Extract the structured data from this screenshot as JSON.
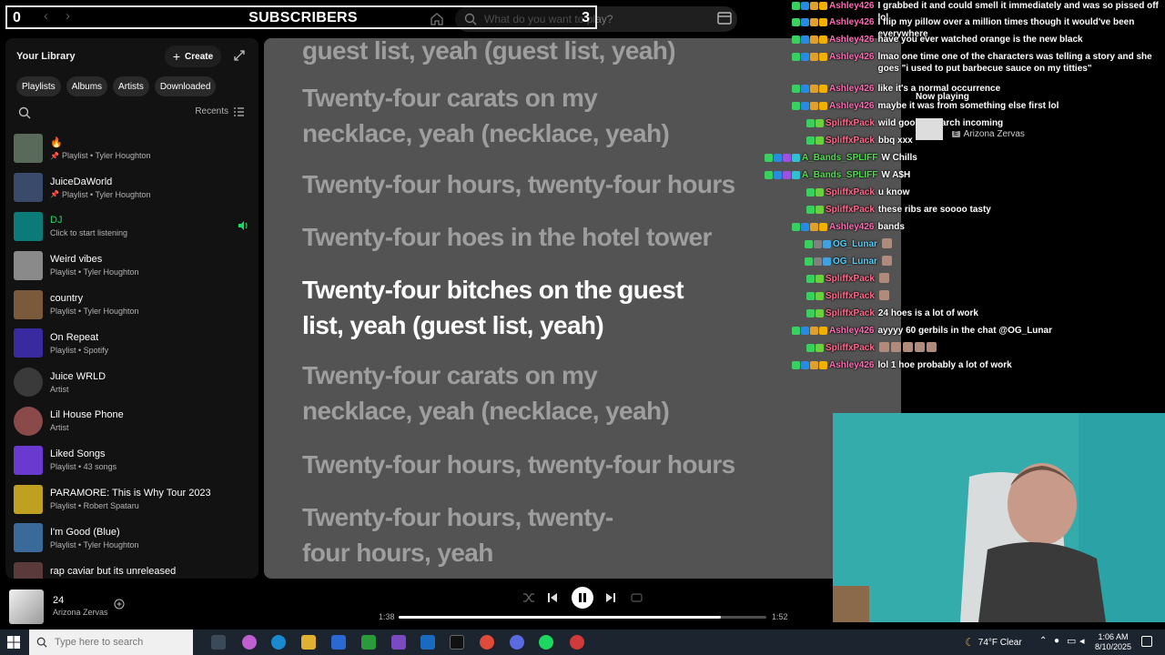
{
  "overlay": {
    "count": "0",
    "title": "SUBSCRIBERS",
    "number": "3"
  },
  "search": {
    "placeholder": "What do you want to play?"
  },
  "library": {
    "title": "Your Library",
    "create_label": "Create",
    "chips": [
      "Playlists",
      "Albums",
      "Artists",
      "Downloaded"
    ],
    "recents_label": "Recents",
    "items": [
      {
        "name": "🔥",
        "sub": "Playlist • Tyler Houghton",
        "thumb": "#5a6a5a",
        "pinned": true
      },
      {
        "name": "JuiceDaWorld",
        "sub": "Playlist • Tyler Houghton",
        "thumb": "#3a4a6a",
        "pinned": true
      },
      {
        "name": "DJ",
        "sub": "Click to start listening",
        "thumb": "#0d7a7a",
        "green": true,
        "playing": true
      },
      {
        "name": "Weird vibes",
        "sub": "Playlist • Tyler Houghton",
        "thumb": "#8a8a8a"
      },
      {
        "name": "country",
        "sub": "Playlist • Tyler Houghton",
        "thumb": "#7a5a3a"
      },
      {
        "name": "On Repeat",
        "sub": "Playlist • Spotify",
        "thumb": "#3a2aa0"
      },
      {
        "name": "Juice WRLD",
        "sub": "Artist",
        "thumb": "#3a3a3a",
        "round": true
      },
      {
        "name": "Lil House Phone",
        "sub": "Artist",
        "thumb": "#8a4a4a",
        "round": true
      },
      {
        "name": "Liked Songs",
        "sub": "Playlist • 43 songs",
        "thumb": "#6a3ad0"
      },
      {
        "name": "PARAMORE: This is Why Tour 2023",
        "sub": "Playlist • Robert Spataru",
        "thumb": "#c0a020"
      },
      {
        "name": "I'm Good (Blue)",
        "sub": "Playlist • Tyler Houghton",
        "thumb": "#3a6a9a"
      },
      {
        "name": "rap caviar but its unreleased",
        "sub": "Playlist • Tyler Houghton",
        "thumb": "#5a3a3a"
      }
    ]
  },
  "lyrics": [
    {
      "text": "guest list, yeah (guest list, yeah)",
      "active": false
    },
    {
      "text": "Twenty-four carats on my necklace, yeah (necklace, yeah)",
      "active": false
    },
    {
      "text": "Twenty-four hours, twenty-four hours",
      "active": false
    },
    {
      "text": "Twenty-four hoes in the hotel tower",
      "active": false
    },
    {
      "text": "Twenty-four bitches on the guest list, yeah (guest list, yeah)",
      "active": true
    },
    {
      "text": "Twenty-four carats on my necklace, yeah (necklace, yeah)",
      "active": false
    },
    {
      "text": "Twenty-four hours, twenty-four hours",
      "active": false
    },
    {
      "text": "Twenty-four hours, twenty-four hours, yeah",
      "active": false
    }
  ],
  "chat": [
    {
      "user": "Ashley426",
      "msg": "I grabbed it and could smell it immediately and was so pissed off lol",
      "color": "#ff69b4"
    },
    {
      "user": "Ashley426",
      "msg": "I flip my pillow over a million times though it would've been everywhere",
      "color": "#ff69b4"
    },
    {
      "user": "Ashley426",
      "msg": "have you ever watched orange is the new black",
      "color": "#ff69b4"
    },
    {
      "user": "Ashley426",
      "msg": "lmao one time one of the characters was telling a story and she goes \"i used to put barbecue sauce on my titties\"",
      "color": "#ff69b4"
    },
    {
      "user": "Ashley426",
      "msg": "like it's a normal occurrence",
      "color": "#ff69b4"
    },
    {
      "user": "Ashley426",
      "msg": "maybe it was from something else first lol",
      "color": "#ff69b4"
    },
    {
      "user": "SpliffxPack",
      "msg": "wild google search incoming",
      "color": "#ff6a8a"
    },
    {
      "user": "SpliffxPack",
      "msg": "bbq xxx",
      "color": "#ff6a8a"
    },
    {
      "user": "A_Bands_SPLIFF",
      "msg": "W Chills",
      "color": "#4fe04f"
    },
    {
      "user": "A_Bands_SPLIFF",
      "msg": "W A$H",
      "color": "#4fe04f"
    },
    {
      "user": "SpliffxPack",
      "msg": "u know",
      "color": "#ff6a8a"
    },
    {
      "user": "SpliffxPack",
      "msg": "these ribs are soooo tasty",
      "color": "#ff6a8a"
    },
    {
      "user": "Ashley426",
      "msg": "bands",
      "color": "#ff69b4"
    },
    {
      "user": "OG_Lunar",
      "msg": "",
      "color": "#4fd0ff"
    },
    {
      "user": "OG_Lunar",
      "msg": "",
      "color": "#4fd0ff"
    },
    {
      "user": "SpliffxPack",
      "msg": "",
      "color": "#ff6a8a"
    },
    {
      "user": "SpliffxPack",
      "msg": "",
      "color": "#ff6a8a"
    },
    {
      "user": "SpliffxPack",
      "msg": "24 hoes is a lot of work",
      "color": "#ff6a8a"
    },
    {
      "user": "Ashley426",
      "msg": "ayyyy 60 gerbils in the chat @OG_Lunar",
      "color": "#ff69b4"
    },
    {
      "user": "SpliffxPack",
      "msg": "",
      "color": "#ff6a8a"
    },
    {
      "user": "Ashley426",
      "msg": "lol 1 hoe probably a lot of work",
      "color": "#ff69b4"
    }
  ],
  "now_playing": {
    "label": "Now playing",
    "artist": "Arizona Zervas"
  },
  "player": {
    "title": "24",
    "artist": "Arizona Zervas",
    "elapsed": "1:38",
    "duration": "1:52",
    "progress": 0.875
  },
  "taskbar": {
    "search_placeholder": "Type here to search",
    "weather": "74°F  Clear",
    "time": "1:06 AM",
    "date": "8/10/2025"
  },
  "colors": {
    "accent": "#1ed760",
    "lyrics_bg": "#535353"
  }
}
